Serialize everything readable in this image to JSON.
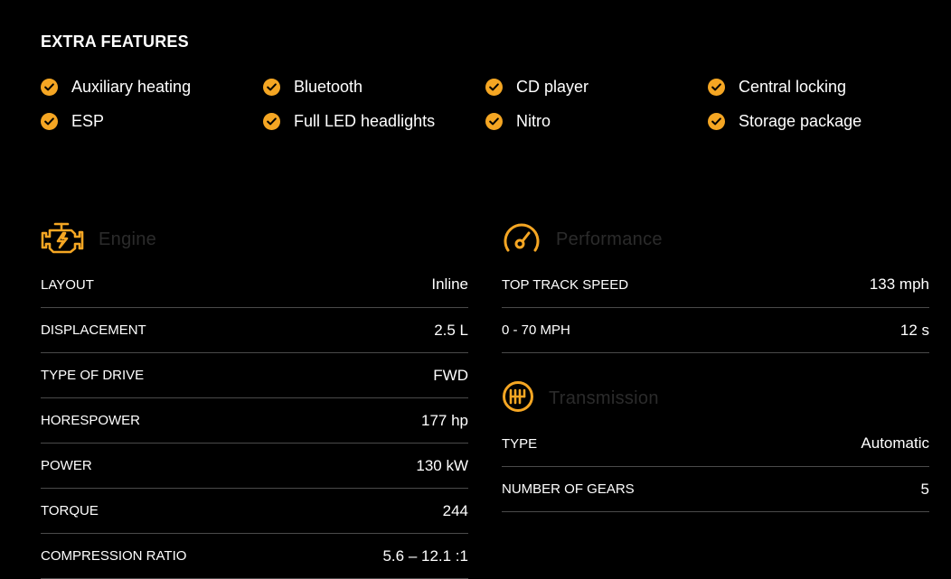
{
  "extra_features": {
    "title": "EXTRA FEATURES",
    "items": [
      {
        "label": "Auxiliary heating"
      },
      {
        "label": "Bluetooth"
      },
      {
        "label": "CD player"
      },
      {
        "label": "Central locking"
      },
      {
        "label": "ESP"
      },
      {
        "label": "Full LED headlights"
      },
      {
        "label": "Nitro"
      },
      {
        "label": "Storage package"
      }
    ]
  },
  "engine": {
    "title": "Engine",
    "icon": "engine-icon",
    "rows": [
      {
        "label": "LAYOUT",
        "value": "Inline"
      },
      {
        "label": "DISPLACEMENT",
        "value": "2.5 L"
      },
      {
        "label": "TYPE OF DRIVE",
        "value": "FWD"
      },
      {
        "label": "HORESPOWER",
        "value": "177 hp"
      },
      {
        "label": "POWER",
        "value": "130 kW"
      },
      {
        "label": "TORQUE",
        "value": "244"
      },
      {
        "label": "COMPRESSION RATIO",
        "value": "5.6 – 12.1 :1"
      }
    ]
  },
  "performance": {
    "title": "Performance",
    "icon": "speedometer-icon",
    "rows": [
      {
        "label": "TOP TRACK SPEED",
        "value": "133 mph"
      },
      {
        "label": "0 - 70 MPH",
        "value": "12 s"
      }
    ]
  },
  "transmission": {
    "title": "Transmission",
    "icon": "gearbox-icon",
    "rows": [
      {
        "label": "TYPE",
        "value": "Automatic"
      },
      {
        "label": "NUMBER OF GEARS",
        "value": "5"
      }
    ]
  },
  "colors": {
    "accent": "#f5a623",
    "background": "#000000",
    "text": "#ffffff",
    "section_title": "#2b2b2b",
    "divider": "#4a4a4a"
  }
}
